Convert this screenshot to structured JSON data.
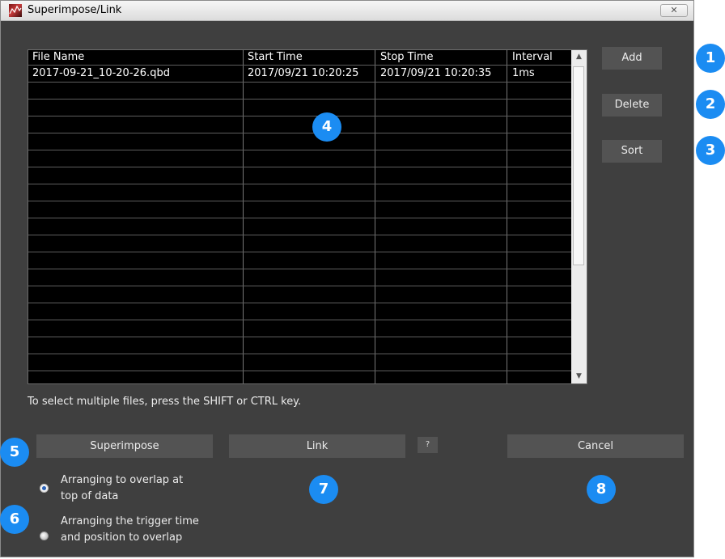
{
  "window": {
    "title": "Superimpose/Link"
  },
  "table": {
    "columns": [
      "File Name",
      "Start Time",
      "Stop Time",
      "Interval"
    ],
    "rows": [
      [
        "2017-09-21_10-20-26.qbd",
        "2017/09/21 10:20:25",
        "2017/09/21 10:20:35",
        "1ms"
      ]
    ]
  },
  "side_buttons": {
    "add": "Add",
    "delete": "Delete",
    "sort": "Sort"
  },
  "hint": "To select multiple files, press the SHIFT or CTRL key.",
  "bottom_buttons": {
    "superimpose": "Superimpose",
    "link": "Link",
    "help": "?",
    "cancel": "Cancel"
  },
  "options": {
    "opt1": {
      "line1": "Arranging to overlap at",
      "line2": "top of data",
      "selected": true
    },
    "opt2": {
      "line1": "Arranging the trigger time",
      "line2": "and position to overlap",
      "selected": false
    }
  },
  "badges": [
    "1",
    "2",
    "3",
    "4",
    "5",
    "6",
    "7",
    "8"
  ],
  "colors": {
    "badge": "#1b8cf2",
    "background": "#3f3f3f",
    "button": "#535353"
  },
  "icons": {
    "close": "close-icon",
    "app": "app-icon"
  }
}
